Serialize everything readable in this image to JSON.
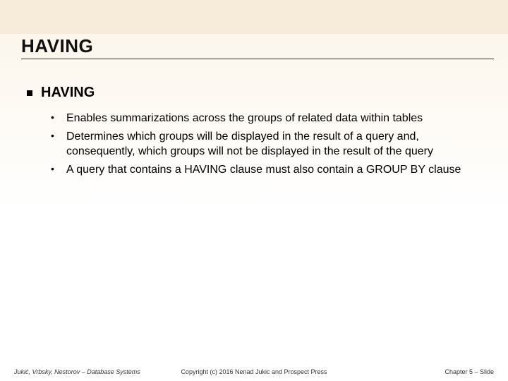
{
  "title": "HAVING",
  "section": {
    "heading": "HAVING",
    "bullets": [
      "Enables summarizations across the groups of related data within tables",
      "Determines which groups will be displayed in the result of a query and, consequently, which groups will not be displayed in the result of the query",
      "A query that contains a HAVING clause must also contain a GROUP BY clause"
    ]
  },
  "footer": {
    "left": "Jukić, Vrbsky, Nestorov – Database Systems",
    "center": "Copyright (c) 2016 Nenad Jukic and Prospect Press",
    "right": "Chapter 5 – Slide"
  }
}
